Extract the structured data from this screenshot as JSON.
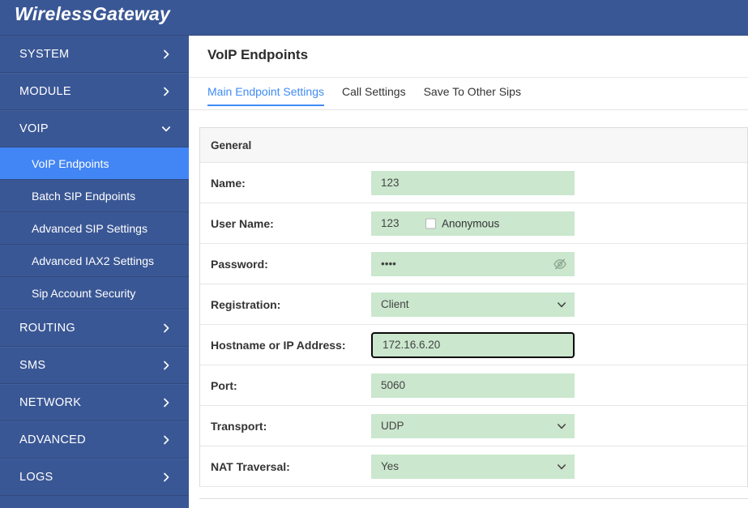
{
  "brand": {
    "title": "WirelessGateway"
  },
  "sidebar": {
    "groups": [
      {
        "label": "SYSTEM",
        "icon": "chevron-right-icon",
        "expanded": false
      },
      {
        "label": "MODULE",
        "icon": "chevron-right-icon",
        "expanded": false
      },
      {
        "label": "VOIP",
        "icon": "chevron-down-icon",
        "expanded": true
      }
    ],
    "voip_items": [
      {
        "label": "VoIP Endpoints",
        "active": true
      },
      {
        "label": "Batch SIP Endpoints",
        "active": false
      },
      {
        "label": "Advanced SIP Settings",
        "active": false
      },
      {
        "label": "Advanced IAX2 Settings",
        "active": false
      },
      {
        "label": "Sip Account Security",
        "active": false
      }
    ],
    "groups_lower": [
      {
        "label": "ROUTING",
        "icon": "chevron-right-icon"
      },
      {
        "label": "SMS",
        "icon": "chevron-right-icon"
      },
      {
        "label": "NETWORK",
        "icon": "chevron-right-icon"
      },
      {
        "label": "ADVANCED",
        "icon": "chevron-right-icon"
      },
      {
        "label": "LOGS",
        "icon": "chevron-right-icon"
      }
    ]
  },
  "main": {
    "page_title": "VoIP Endpoints",
    "tabs": [
      {
        "label": "Main Endpoint Settings",
        "active": true
      },
      {
        "label": "Call Settings",
        "active": false
      },
      {
        "label": "Save To Other Sips",
        "active": false
      }
    ],
    "section": {
      "title": "General"
    },
    "fields": {
      "name": {
        "label": "Name:",
        "value": "123",
        "placeholder": ""
      },
      "user_name": {
        "label": "User Name:",
        "value": "123",
        "placeholder": "",
        "checkbox_label": "Anonymous",
        "checkbox_checked": false
      },
      "password": {
        "label": "Password:",
        "value": "••••",
        "placeholder": "",
        "toggle_icon": "eye-slash-icon"
      },
      "registration": {
        "label": "Registration:",
        "value": "Client",
        "icon": "chevron-down-icon"
      },
      "hostname": {
        "label": "Hostname or IP Address:",
        "value": "172.16.6.20",
        "placeholder": "",
        "focused": true
      },
      "port": {
        "label": "Port:",
        "value": "5060",
        "placeholder": ""
      },
      "transport": {
        "label": "Transport:",
        "value": "UDP",
        "icon": "chevron-down-icon"
      },
      "nat_traversal": {
        "label": "NAT Traversal:",
        "value": "Yes",
        "icon": "chevron-down-icon"
      }
    }
  },
  "colors": {
    "sidebar_bg": "#3a5795",
    "sidebar_active": "#4285f4",
    "accent": "#3f8bf5",
    "input_bg": "#cbe7ce",
    "section_bg": "#f7f7f7"
  }
}
